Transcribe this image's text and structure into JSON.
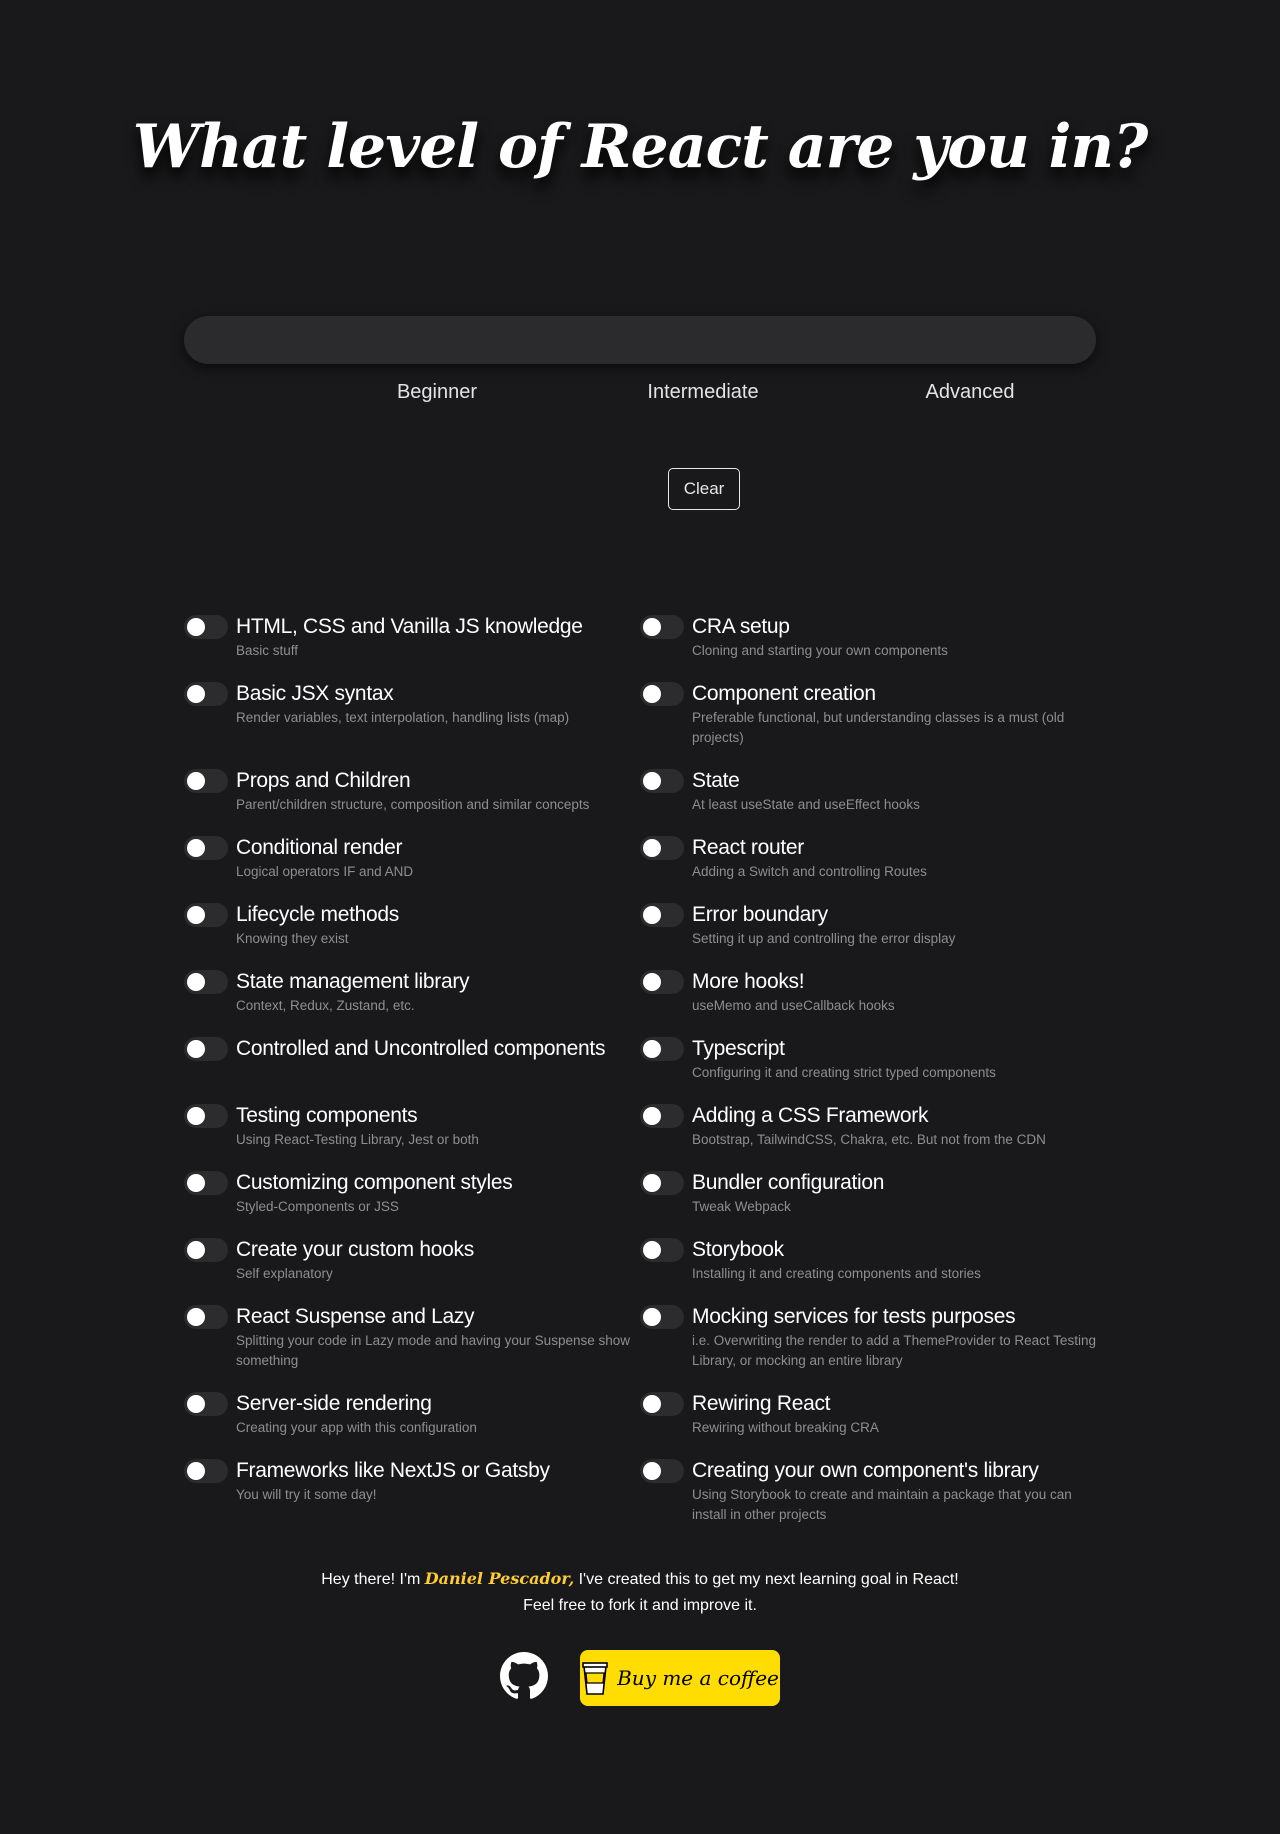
{
  "title": "What level of React are you in?",
  "progress": {
    "value": 0
  },
  "levels": [
    "Beginner",
    "Intermediate",
    "Advanced"
  ],
  "clear_label": "Clear",
  "skills": [
    {
      "left": {
        "label": "HTML, CSS and Vanilla JS knowledge",
        "desc": "Basic stuff"
      },
      "right": {
        "label": "CRA setup",
        "desc": "Cloning and starting your own components"
      }
    },
    {
      "left": {
        "label": "Basic JSX syntax",
        "desc": "Render variables, text interpolation, handling lists (map)"
      },
      "right": {
        "label": "Component creation",
        "desc": "Preferable functional, but understanding classes is a must (old projects)"
      }
    },
    {
      "left": {
        "label": "Props and Children",
        "desc": "Parent/children structure, composition and similar concepts"
      },
      "right": {
        "label": "State",
        "desc": "At least useState and useEffect hooks"
      }
    },
    {
      "left": {
        "label": "Conditional render",
        "desc": "Logical operators IF and AND"
      },
      "right": {
        "label": "React router",
        "desc": "Adding a Switch and controlling Routes"
      }
    },
    {
      "left": {
        "label": "Lifecycle methods",
        "desc": "Knowing they exist"
      },
      "right": {
        "label": "Error boundary",
        "desc": "Setting it up and controlling the error display"
      }
    },
    {
      "left": {
        "label": "State management library",
        "desc": "Context, Redux, Zustand, etc."
      },
      "right": {
        "label": "More hooks!",
        "desc": "useMemo and useCallback hooks"
      }
    },
    {
      "left": {
        "label": "Controlled and Uncontrolled components",
        "desc": ""
      },
      "right": {
        "label": "Typescript",
        "desc": "Configuring it and creating strict typed components"
      }
    },
    {
      "left": {
        "label": "Testing components",
        "desc": "Using React-Testing Library, Jest or both"
      },
      "right": {
        "label": "Adding a CSS Framework",
        "desc": "Bootstrap, TailwindCSS, Chakra, etc. But not from the CDN"
      }
    },
    {
      "left": {
        "label": "Customizing component styles",
        "desc": "Styled-Components or JSS"
      },
      "right": {
        "label": "Bundler configuration",
        "desc": "Tweak Webpack"
      }
    },
    {
      "left": {
        "label": "Create your custom hooks",
        "desc": "Self explanatory"
      },
      "right": {
        "label": "Storybook",
        "desc": "Installing it and creating components and stories"
      }
    },
    {
      "left": {
        "label": "React Suspense and Lazy",
        "desc": "Splitting your code in Lazy mode and having your Suspense show something"
      },
      "right": {
        "label": "Mocking services for tests purposes",
        "desc": "i.e. Overwriting the render to add a ThemeProvider to React Testing Library, or mocking an entire library"
      }
    },
    {
      "left": {
        "label": "Server-side rendering",
        "desc": "Creating your app with this configuration"
      },
      "right": {
        "label": "Rewiring React",
        "desc": "Rewiring without breaking CRA"
      }
    },
    {
      "left": {
        "label": "Frameworks like NextJS or Gatsby",
        "desc": "You will try it some day!"
      },
      "right": {
        "label": "Creating your own component's library",
        "desc": "Using Storybook to create and maintain a package that you can install in other projects"
      }
    }
  ],
  "footer": {
    "before": "Hey there! I'm ",
    "author": "Daniel Pescador,",
    "after": " I've created this to get my next learning goal in React!",
    "line2": "Feel free to fork it and improve it.",
    "coffee_label": "Buy me a coffee",
    "github_icon": "github-icon",
    "coffee_icon": "coffee-cup-icon",
    "coffee_color": "#ffdd00"
  }
}
